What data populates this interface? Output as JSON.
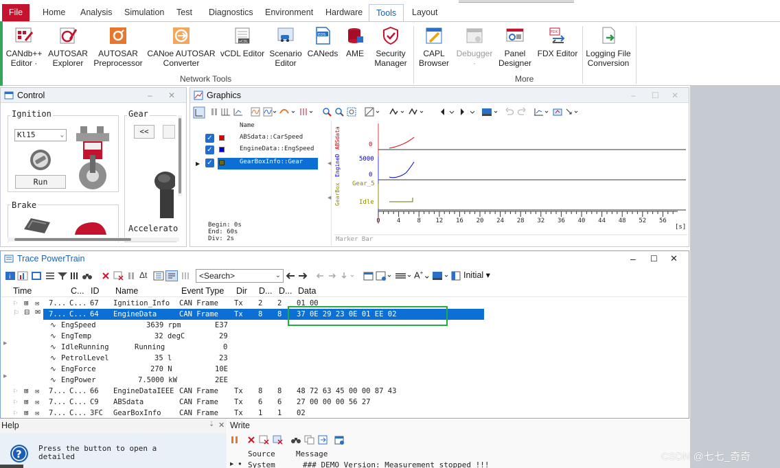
{
  "ribbon": {
    "tabs": [
      "File",
      "Home",
      "Analysis",
      "Simulation",
      "Test",
      "Diagnostics",
      "Environment",
      "Hardware",
      "Tools",
      "Layout"
    ],
    "active_tab": "Tools",
    "buttons": [
      {
        "line1": "CANdb++",
        "line2": "Editor ·"
      },
      {
        "line1": "AUTOSAR",
        "line2": "Explorer"
      },
      {
        "line1": "AUTOSAR",
        "line2": "Preprocessor"
      },
      {
        "line1": "CANoe AUTOSAR",
        "line2": "Converter"
      },
      {
        "line1": "vCDL Editor",
        "line2": ""
      },
      {
        "line1": "Scenario",
        "line2": "Editor"
      },
      {
        "line1": "CANeds",
        "line2": ""
      },
      {
        "line1": "AME",
        "line2": ""
      },
      {
        "line1": "Security",
        "line2": "Manager"
      },
      {
        "line1": "CAPL",
        "line2": "Browser"
      },
      {
        "line1": "Debugger",
        "line2": "·"
      },
      {
        "line1": "Panel",
        "line2": "Designer"
      },
      {
        "line1": "FDX Editor",
        "line2": ""
      },
      {
        "line1": "Logging File",
        "line2": "Conversion"
      }
    ],
    "groups": {
      "network_tools": "Network Tools",
      "more": "More"
    }
  },
  "control": {
    "title": "Control",
    "ignition_label": "Ignition",
    "ignition_value": "Kl15",
    "run_label": "Run",
    "gear_label": "Gear",
    "gear_btn": "<<",
    "brake_label": "Brake",
    "accel_label": "Accelerato"
  },
  "graphics": {
    "title": "Graphics",
    "list_header": "Name",
    "signals": [
      {
        "name": "ABSdata::CarSpeed",
        "color": "#e00000"
      },
      {
        "name": "EngineData::EngSpeed",
        "color": "#0000d0"
      },
      {
        "name": "GearBoxInfo::Gear",
        "color": "#6b6b00"
      }
    ],
    "begin": "Begin: 0s",
    "end": "End: 60s",
    "div": "Div: 2s",
    "axis_labels": {
      "abs": "ABSdata",
      "eng": "EngineD",
      "gear": "GearBox"
    },
    "y_ticks": {
      "abs": "0",
      "eng_top": "5000",
      "eng_bottom": "0",
      "gear_top": "Gear_5",
      "gear_bottom": "Idle"
    },
    "x_ticks": [
      "0",
      "4",
      "8",
      "12",
      "16",
      "20",
      "24",
      "28",
      "32",
      "36",
      "40",
      "44",
      "48",
      "52",
      "56"
    ],
    "x_unit": "[s]",
    "marker_bar": "Marker Bar"
  },
  "trace": {
    "title": "Trace PowerTrain",
    "search_placeholder": "<Search>",
    "filter_label": "Initial",
    "columns": [
      "Time",
      "C...",
      "ID",
      "Name",
      "Event Type",
      "Dir",
      "D...",
      "D...",
      "Data"
    ],
    "rows": [
      {
        "time": "7...",
        "ch": "C...",
        "id": "67",
        "name": "Ignition_Info",
        "type": "CAN Frame",
        "dir": "Tx",
        "dlc": "2",
        "dlen": "2",
        "data": "01 00"
      },
      {
        "time": "7...",
        "ch": "C...",
        "id": "64",
        "name": "EngineData",
        "type": "CAN Frame",
        "dir": "Tx",
        "dlc": "8",
        "dlen": "8",
        "data": "37 0E 29 23 0E 01 EE 02"
      },
      {
        "time": "7...",
        "ch": "C...",
        "id": "66",
        "name": "EngineDataIEEE",
        "type": "CAN Frame",
        "dir": "Tx",
        "dlc": "8",
        "dlen": "8",
        "data": "48 72 63 45 00 00 87 43"
      },
      {
        "time": "7...",
        "ch": "C...",
        "id": "C9",
        "name": "ABSdata",
        "type": "CAN Frame",
        "dir": "Tx",
        "dlc": "6",
        "dlen": "6",
        "data": "27 00 00 00 56 27"
      },
      {
        "time": "7...",
        "ch": "C...",
        "id": "3FC",
        "name": "GearBoxInfo",
        "type": "CAN Frame",
        "dir": "Tx",
        "dlc": "1",
        "dlen": "1",
        "data": "02"
      }
    ],
    "signals": [
      {
        "name": "EngSpeed",
        "value": "3639 rpm",
        "raw": "E37"
      },
      {
        "name": "EngTemp",
        "value": "32 degC",
        "raw": "29"
      },
      {
        "name": "IdleRunning",
        "value": "Running",
        "raw": "0"
      },
      {
        "name": "PetrolLevel",
        "value": "35 l",
        "raw": "23"
      },
      {
        "name": "EngForce",
        "value": "270 N",
        "raw": "10E"
      },
      {
        "name": "EngPower",
        "value": "7.5000 kW",
        "raw": "2EE"
      }
    ]
  },
  "help": {
    "title": "Help",
    "text_line1": "Press the button to open a",
    "text_line2": "detailed"
  },
  "write": {
    "title": "Write",
    "col_source": "Source",
    "col_message": "Message",
    "row_source": "System",
    "row_message": "### DEMO Version: Measurement stopped !!!"
  },
  "watermark": "CSDN @七七_奇奇",
  "colors": {
    "accent": "#1a63b8",
    "file_tab": "#c4122f",
    "selection": "#0b6fd6",
    "highlight_box": "#22aa44"
  }
}
